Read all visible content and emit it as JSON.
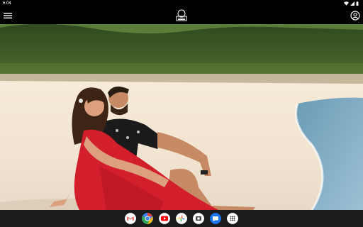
{
  "status_bar": {
    "time": "6:04",
    "icons": [
      "wifi-icon",
      "signal-icon",
      "battery-icon"
    ]
  },
  "app_bar": {
    "menu_icon": "menu-icon",
    "logo_icon": "logo-icon",
    "profile_icon": "account-circle-icon"
  },
  "photo": {
    "subject": "couple-on-white-beach"
  },
  "dock": {
    "apps": [
      {
        "name": "gmail-icon",
        "color": "#ea4335"
      },
      {
        "name": "chrome-icon",
        "color": "#4285f4"
      },
      {
        "name": "youtube-icon",
        "color": "#ff0000"
      },
      {
        "name": "photos-icon",
        "color": "#fbbc04"
      },
      {
        "name": "camera-icon",
        "color": "#ffffff"
      },
      {
        "name": "messages-icon",
        "color": "#1a73e8"
      },
      {
        "name": "app-drawer-icon",
        "color": "#ffffff"
      }
    ]
  },
  "colors": {
    "bar": "#000000",
    "dock": "#1c1c1c"
  }
}
